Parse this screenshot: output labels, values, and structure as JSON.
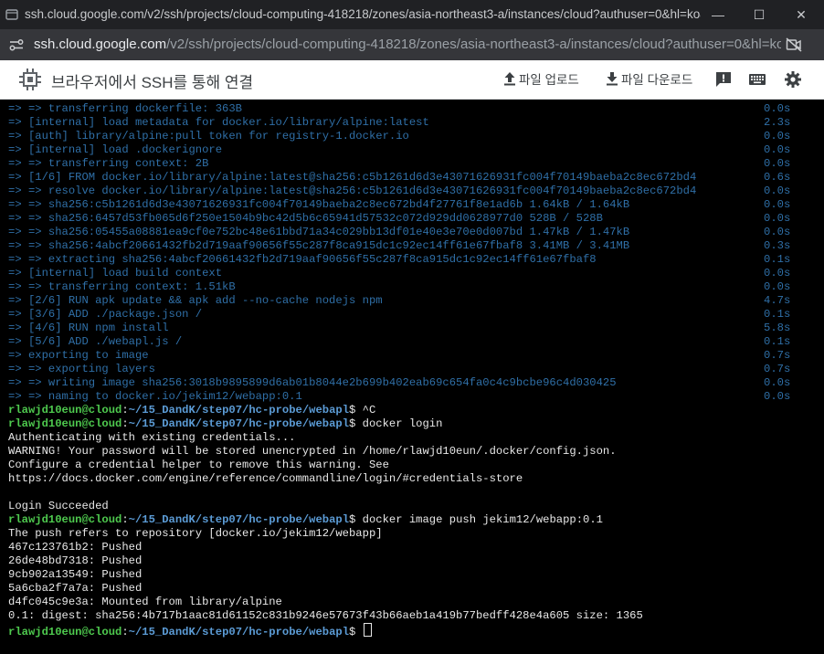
{
  "window": {
    "title": "ssh.cloud.google.com/v2/ssh/projects/cloud-computing-418218/zones/asia-northeast3-a/instances/cloud?authuser=0&hl=ko&project...",
    "controls": {
      "minimize": "—",
      "maximize": "☐",
      "close": "✕"
    }
  },
  "address": {
    "host": "ssh.cloud.google.com",
    "path": "/v2/ssh/projects/cloud-computing-418218/zones/asia-northeast3-a/instances/cloud?authuser=0&hl=ko&..."
  },
  "header": {
    "title": "브라우저에서 SSH를 통해 연결",
    "upload_label": "파일 업로드",
    "download_label": "파일 다운로드"
  },
  "icons": [
    "site-info-icon",
    "camera-off-icon",
    "chip-icon",
    "upload-icon",
    "download-icon",
    "feedback-icon",
    "keyboard-icon",
    "gear-icon"
  ],
  "colors": {
    "build_text": "#2f6fa7",
    "prompt_user": "#4ec94e",
    "prompt_path": "#5b9bd5",
    "terminal_bg": "#000000"
  },
  "build_lines": [
    {
      "text": "=> => transferring dockerfile: 363B",
      "time": "0.0s"
    },
    {
      "text": "=> [internal] load metadata for docker.io/library/alpine:latest",
      "time": "2.3s"
    },
    {
      "text": "=> [auth] library/alpine:pull token for registry-1.docker.io",
      "time": "0.0s"
    },
    {
      "text": "=> [internal] load .dockerignore",
      "time": "0.0s"
    },
    {
      "text": "=> => transferring context: 2B",
      "time": "0.0s"
    },
    {
      "text": "=> [1/6] FROM docker.io/library/alpine:latest@sha256:c5b1261d6d3e43071626931fc004f70149baeba2c8ec672bd4",
      "time": "0.6s"
    },
    {
      "text": "=> => resolve docker.io/library/alpine:latest@sha256:c5b1261d6d3e43071626931fc004f70149baeba2c8ec672bd4",
      "time": "0.0s"
    },
    {
      "text": "=> => sha256:c5b1261d6d3e43071626931fc004f70149baeba2c8ec672bd4f27761f8e1ad6b 1.64kB / 1.64kB",
      "time": "0.0s"
    },
    {
      "text": "=> => sha256:6457d53fb065d6f250e1504b9bc42d5b6c65941d57532c072d929dd0628977d0 528B / 528B",
      "time": "0.0s"
    },
    {
      "text": "=> => sha256:05455a08881ea9cf0e752bc48e61bbd71a34c029bb13df01e40e3e70e0d007bd 1.47kB / 1.47kB",
      "time": "0.0s"
    },
    {
      "text": "=> => sha256:4abcf20661432fb2d719aaf90656f55c287f8ca915dc1c92ec14ff61e67fbaf8 3.41MB / 3.41MB",
      "time": "0.3s"
    },
    {
      "text": "=> => extracting sha256:4abcf20661432fb2d719aaf90656f55c287f8ca915dc1c92ec14ff61e67fbaf8",
      "time": "0.1s"
    },
    {
      "text": "=> [internal] load build context",
      "time": "0.0s"
    },
    {
      "text": "=> => transferring context: 1.51kB",
      "time": "0.0s"
    },
    {
      "text": "=> [2/6] RUN apk update && apk add --no-cache nodejs npm",
      "time": "4.7s"
    },
    {
      "text": "=> [3/6] ADD ./package.json /",
      "time": "0.1s"
    },
    {
      "text": "=> [4/6] RUN npm install",
      "time": "5.8s"
    },
    {
      "text": "=> [5/6] ADD ./webapl.js /",
      "time": "0.1s"
    },
    {
      "text": "=> exporting to image",
      "time": "0.7s"
    },
    {
      "text": "=> => exporting layers",
      "time": "0.7s"
    },
    {
      "text": "=> => writing image sha256:3018b9895899d6ab01b8044e2b699b402eab69c654fa0c4c9bcbe96c4d030425",
      "time": "0.0s"
    },
    {
      "text": "=> => naming to docker.io/jekim12/webapp:0.1",
      "time": "0.0s"
    }
  ],
  "prompt": {
    "user": "rlawjd10eun@cloud",
    "sep": ":",
    "path": "~/15_DandK/step07/hc-probe/webapl",
    "symbol": "$ "
  },
  "session": {
    "cmd1": "^C",
    "cmd2": "docker login",
    "login_output": [
      "Authenticating with existing credentials...",
      "WARNING! Your password will be stored unencrypted in /home/rlawjd10eun/.docker/config.json.",
      "Configure a credential helper to remove this warning. See",
      "https://docs.docker.com/engine/reference/commandline/login/#credentials-store",
      "",
      "Login Succeeded"
    ],
    "cmd3": "docker image push jekim12/webapp:0.1",
    "push_output": [
      "The push refers to repository [docker.io/jekim12/webapp]",
      "467c123761b2: Pushed",
      "26de48bd7318: Pushed",
      "9cb902a13549: Pushed",
      "5a6cba2f7a7a: Pushed",
      "d4fc045c9e3a: Mounted from library/alpine",
      "0.1: digest: sha256:4b717b1aac81d61152c831b9246e57673f43b66aeb1a419b77bedff428e4a605 size: 1365"
    ]
  }
}
